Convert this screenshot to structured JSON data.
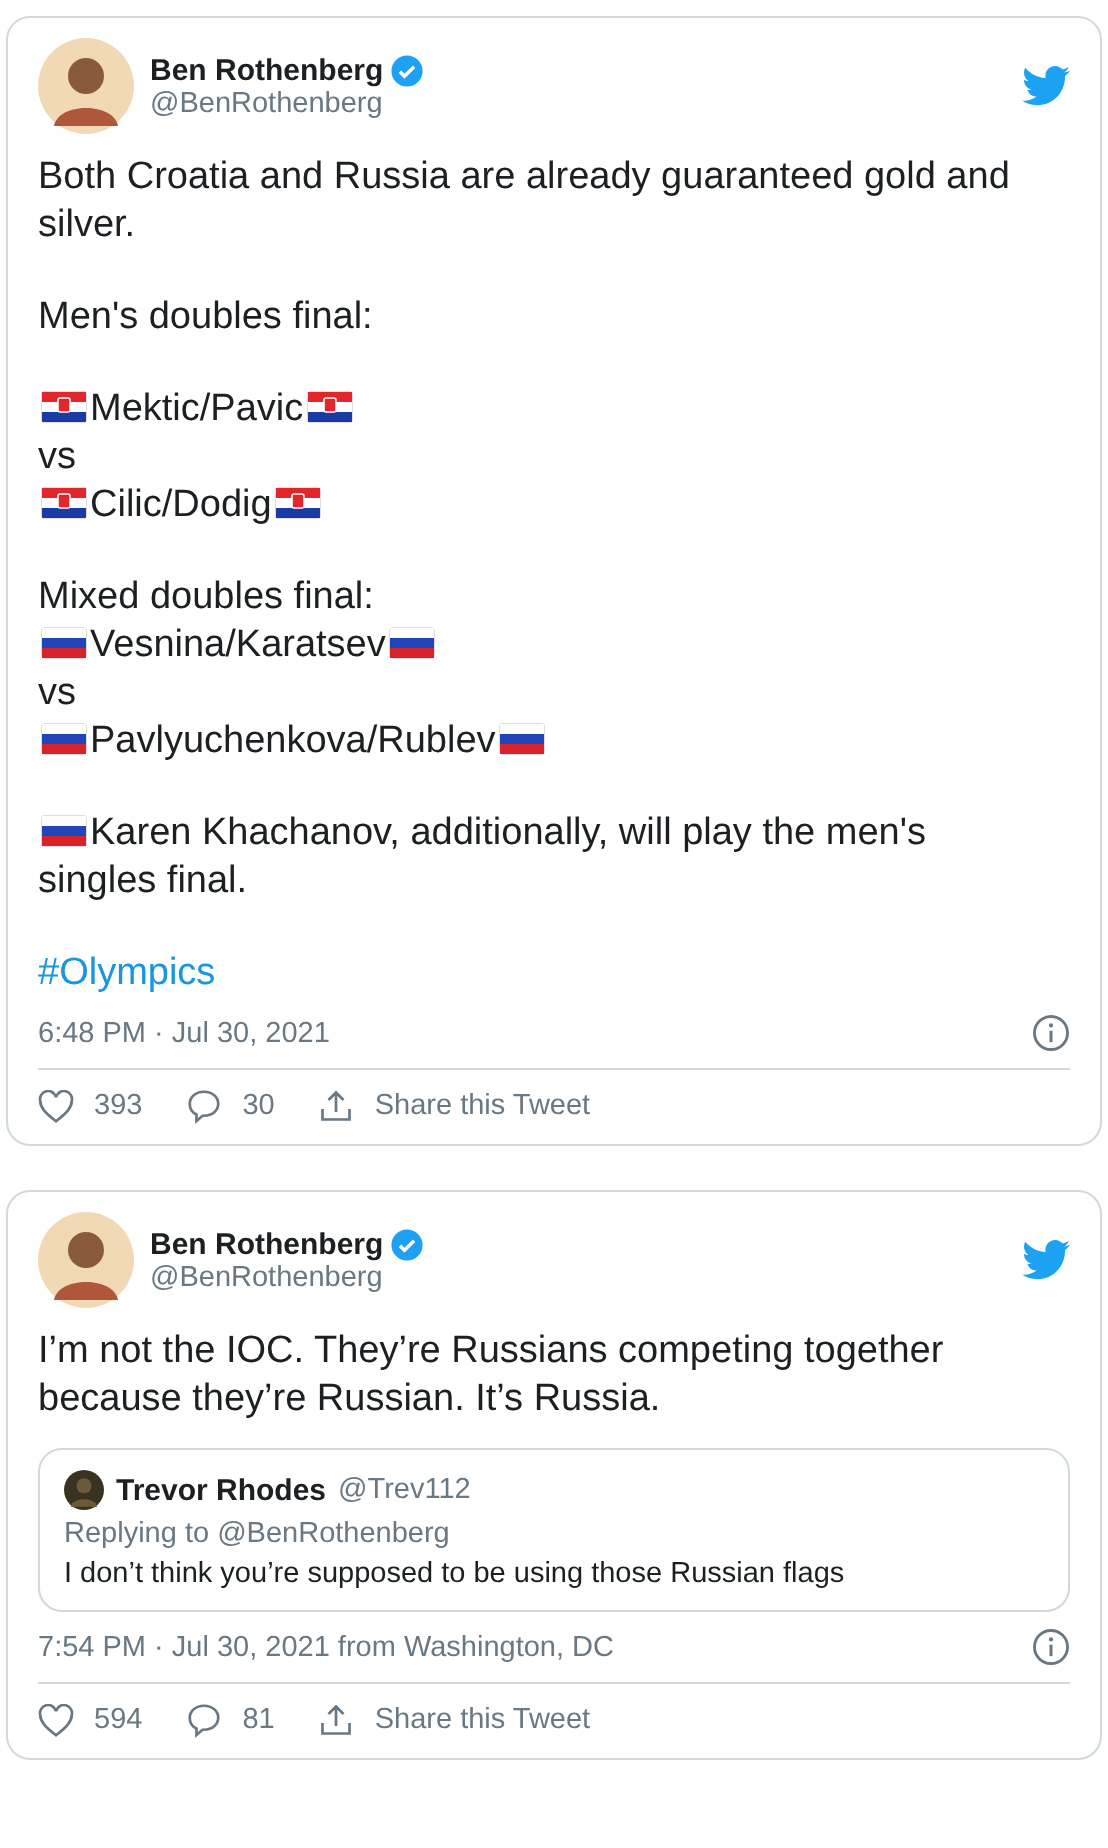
{
  "tweets": [
    {
      "author": {
        "name": "Ben Rothenberg",
        "handle": "@BenRothenberg",
        "verified": true
      },
      "paragraphs": [
        [
          [
            {
              "kind": "text",
              "text": "Both Croatia and Russia are already guaranteed gold and silver."
            }
          ]
        ],
        [
          [
            {
              "kind": "text",
              "text": "Men's doubles final:"
            }
          ]
        ],
        [
          [
            {
              "kind": "croatian_flag"
            },
            {
              "kind": "text",
              "text": "Mektic/Pavic"
            },
            {
              "kind": "croatian_flag"
            }
          ],
          [
            {
              "kind": "text",
              "text": "vs"
            }
          ],
          [
            {
              "kind": "croatian_flag"
            },
            {
              "kind": "text",
              "text": "Cilic/Dodig"
            },
            {
              "kind": "croatian_flag"
            }
          ]
        ],
        [
          [
            {
              "kind": "text",
              "text": "Mixed doubles final:"
            }
          ],
          [
            {
              "kind": "russian_flag"
            },
            {
              "kind": "text",
              "text": "Vesnina/Karatsev"
            },
            {
              "kind": "russian_flag"
            }
          ],
          [
            {
              "kind": "text",
              "text": "vs"
            }
          ],
          [
            {
              "kind": "russian_flag"
            },
            {
              "kind": "text",
              "text": "Pavlyuchenkova/Rublev"
            },
            {
              "kind": "russian_flag"
            }
          ]
        ],
        [
          [
            {
              "kind": "russian_flag"
            },
            {
              "kind": "text",
              "text": "Karen Khachanov, additionally, will play the men's"
            }
          ],
          [
            {
              "kind": "text",
              "text": "singles final."
            }
          ]
        ],
        [
          [
            {
              "kind": "hashtag",
              "text": "#Olympics"
            }
          ]
        ]
      ],
      "timestamp": "6:48 PM · Jul 30, 2021",
      "likes": "393",
      "replies": "30",
      "share": "Share this Tweet"
    },
    {
      "author": {
        "name": "Ben Rothenberg",
        "handle": "@BenRothenberg",
        "verified": true
      },
      "paragraphs": [
        [
          [
            {
              "kind": "text",
              "text": "I’m not the IOC. They’re Russians competing together because they’re Russian. It’s Russia."
            }
          ]
        ]
      ],
      "quote": {
        "name": "Trevor Rhodes",
        "handle": "@Trev112",
        "replying_label": "Replying to",
        "replying_handle": "@BenRothenberg",
        "text": "I don’t think you’re supposed to be using those Russian flags"
      },
      "timestamp": "7:54 PM · Jul 30, 2021 from Washington, DC",
      "likes": "594",
      "replies": "81",
      "share": "Share this Tweet"
    }
  ]
}
